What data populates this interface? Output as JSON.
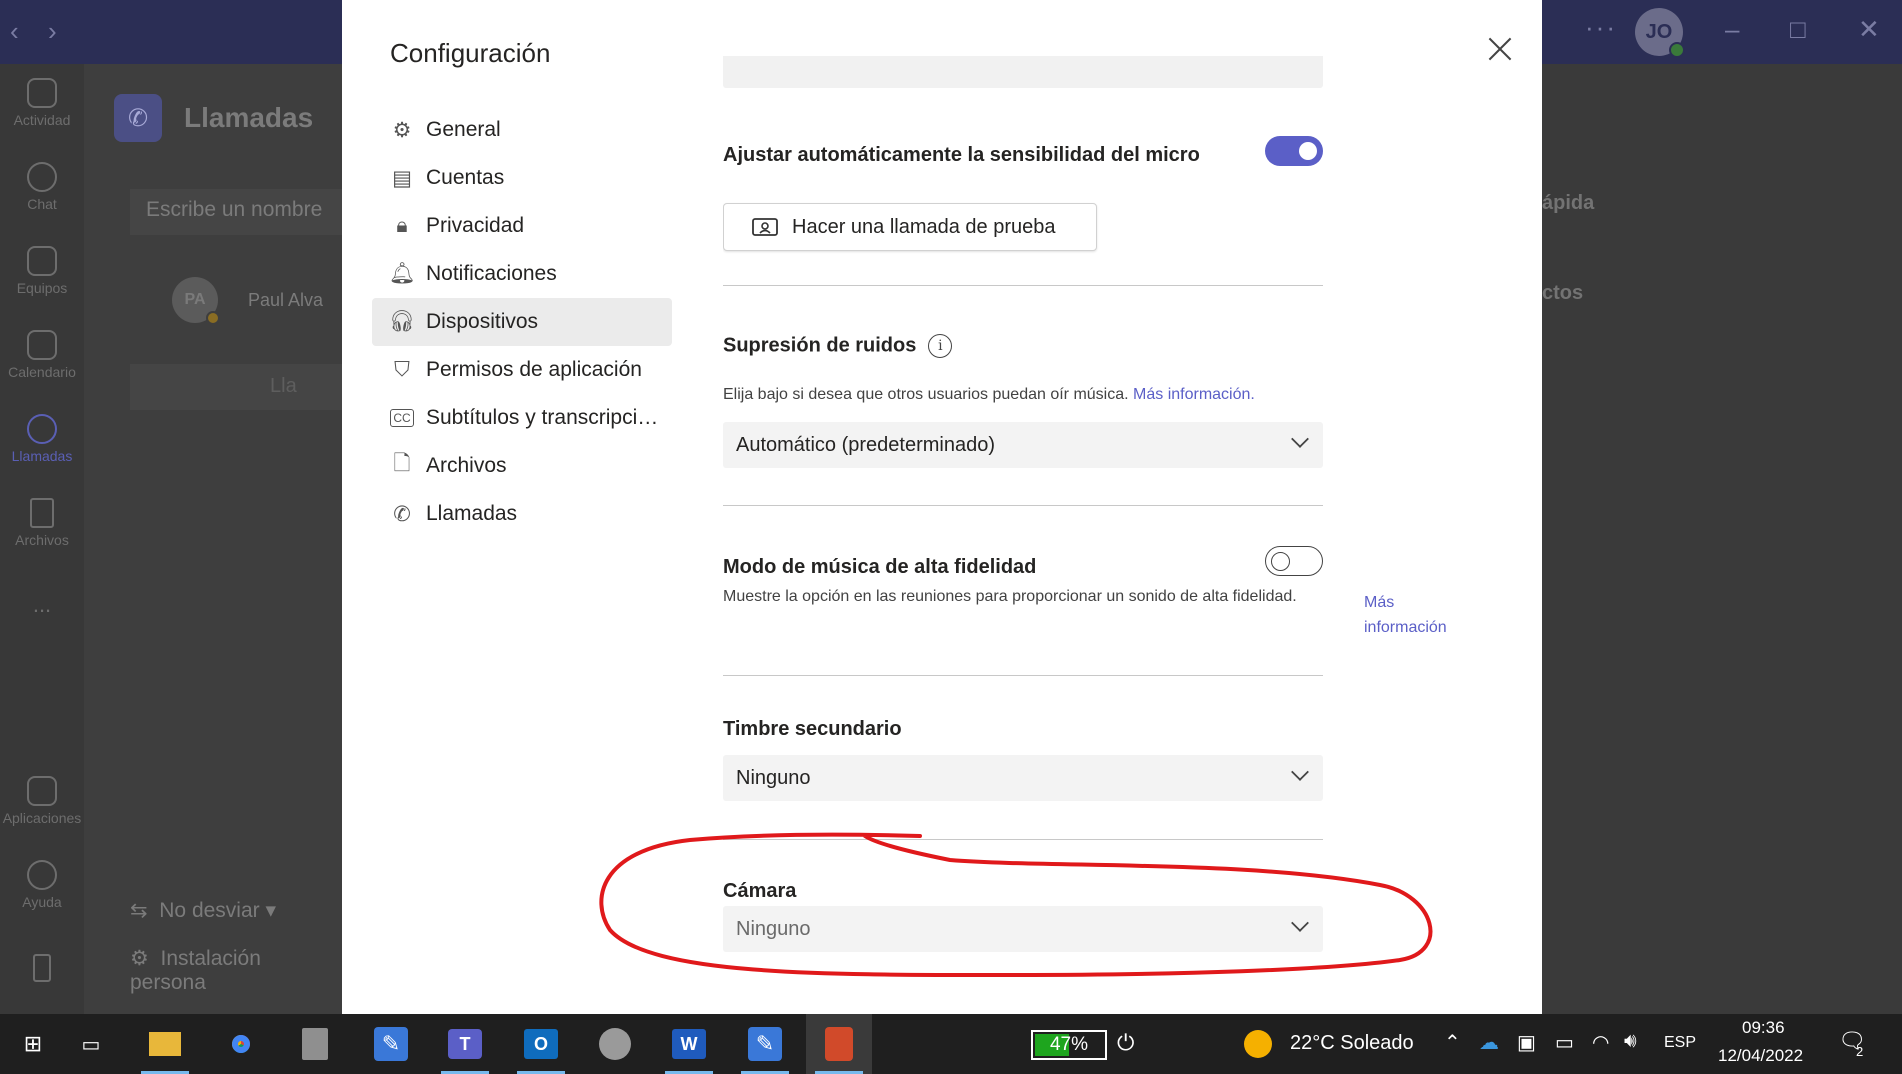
{
  "app": {
    "user_initials": "JO",
    "rail": [
      {
        "label": "Actividad",
        "icon": "bell-icon"
      },
      {
        "label": "Chat",
        "icon": "chat-icon"
      },
      {
        "label": "Equipos",
        "icon": "teams-icon"
      },
      {
        "label": "Calendario",
        "icon": "calendar-icon"
      },
      {
        "label": "Llamadas",
        "icon": "phone-icon",
        "active": true
      },
      {
        "label": "Archivos",
        "icon": "file-icon"
      },
      {
        "label": "...",
        "icon": "more-icon"
      },
      {
        "label": "Aplicaciones",
        "icon": "apps-icon"
      },
      {
        "label": "Ayuda",
        "icon": "help-icon"
      }
    ],
    "left_pane": {
      "title": "Llamadas",
      "search_placeholder": "Escribe un nombre",
      "contact_initials": "PA",
      "contact_name": "Paul Alva",
      "call_button_label": "Lla",
      "forward_label": "No desviar",
      "setup_label": "Instalación persona"
    },
    "right_texts": [
      "ápida",
      "ctos"
    ]
  },
  "dialog": {
    "title": "Configuración",
    "nav": [
      {
        "label": "General",
        "icon": "gear-icon"
      },
      {
        "label": "Cuentas",
        "icon": "accounts-icon"
      },
      {
        "label": "Privacidad",
        "icon": "lock-icon"
      },
      {
        "label": "Notificaciones",
        "icon": "bell-icon"
      },
      {
        "label": "Dispositivos",
        "icon": "headset-icon",
        "active": true
      },
      {
        "label": "Permisos de aplicación",
        "icon": "shield-icon"
      },
      {
        "label": "Subtítulos y transcripcio...",
        "icon": "captions-icon"
      },
      {
        "label": "Archivos",
        "icon": "file-icon"
      },
      {
        "label": "Llamadas",
        "icon": "phone-icon"
      }
    ],
    "mic_sensitivity": {
      "label": "Ajustar automáticamente la sensibilidad del micro",
      "enabled": true
    },
    "test_call_label": "Hacer una llamada de prueba",
    "noise": {
      "label": "Supresión de ruidos",
      "description": "Elija bajo si desea que otros usuarios puedan oír música.",
      "link": "Más información.",
      "value": "Automático (predeterminado)"
    },
    "hifi_music": {
      "label": "Modo de música de alta fidelidad",
      "enabled": false,
      "description": "Muestre la opción en las reuniones para proporcionar un sonido de alta fidelidad.",
      "link": "Más información"
    },
    "secondary_ringer": {
      "label": "Timbre secundario",
      "value": "Ninguno"
    },
    "camera": {
      "label": "Cámara",
      "value": "Ninguno"
    }
  },
  "taskbar": {
    "battery_percent": "47%",
    "weather": "22°C  Soleado",
    "language": "ESP",
    "time": "09:36",
    "date": "12/04/2022",
    "notifications": "2"
  },
  "colors": {
    "accent": "#5b5fc7",
    "annotation": "#e0191b",
    "titlebar": "#2b2e55"
  }
}
